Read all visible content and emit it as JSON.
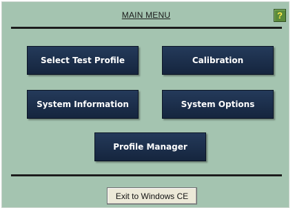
{
  "header": {
    "title": "MAIN MENU",
    "help_label": "?"
  },
  "menu": {
    "select_test_profile": "Select Test Profile",
    "calibration": "Calibration",
    "system_information": "System Information",
    "system_options": "System Options",
    "profile_manager": "Profile Manager"
  },
  "footer": {
    "exit_label": "Exit to Windows CE"
  },
  "colors": {
    "background": "#a4c4b0",
    "button": "#1c2f4b",
    "button_text": "#ffffff",
    "help_button": "#5a8a3a",
    "help_glyph": "#ffe84a"
  },
  "icons": {
    "help": "help-icon"
  }
}
